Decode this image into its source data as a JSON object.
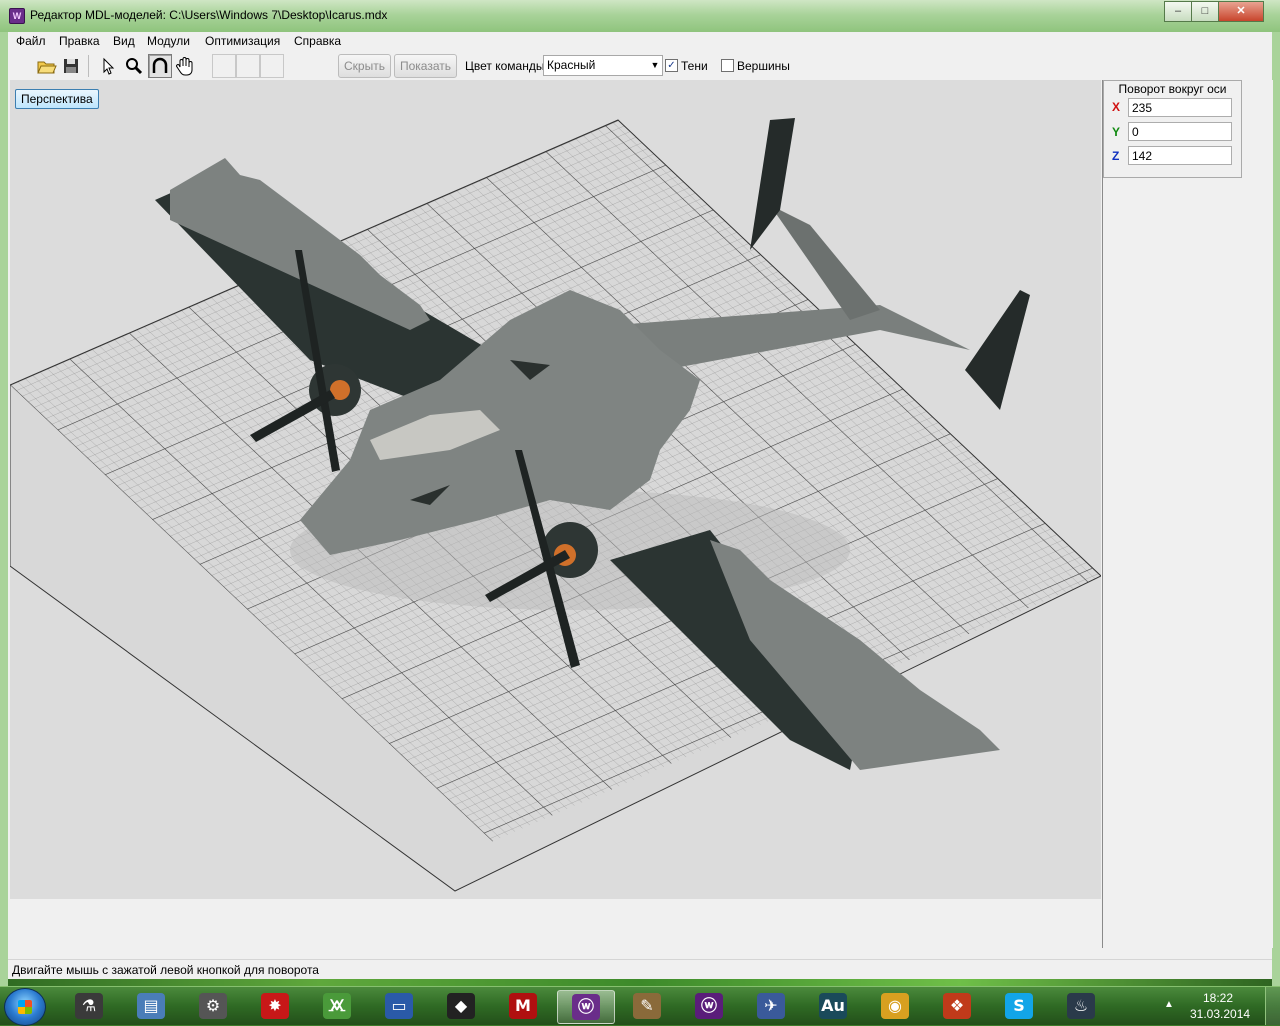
{
  "window": {
    "title": "Редактор MDL-моделей: C:\\Users\\Windows 7\\Desktop\\Icarus.mdx",
    "controls": {
      "minimize": "–",
      "maximize": "□",
      "close": "✕"
    }
  },
  "menu": [
    "Файл",
    "Правка",
    "Вид",
    "Модули",
    "Оптимизация",
    "Справка"
  ],
  "toolbar": {
    "tools": [
      {
        "name": "open-icon",
        "glyph": "📂"
      },
      {
        "name": "save-icon",
        "glyph": "💾"
      },
      {
        "name": "select-icon",
        "glyph": "↖"
      },
      {
        "name": "zoom-icon",
        "glyph": "🔍"
      },
      {
        "name": "rotate-icon",
        "glyph": "∩",
        "pressed": true
      },
      {
        "name": "pan-hand-icon",
        "glyph": "✋"
      }
    ],
    "hide_label": "Скрыть",
    "show_label": "Показать",
    "team_color_label": "Цвет команды:",
    "team_color_value": "Красный",
    "shadows_label": "Тени",
    "shadows_checked": true,
    "vertices_label": "Вершины",
    "vertices_checked": false
  },
  "viewport": {
    "mode_label": "Перспектива"
  },
  "rotation": {
    "title": "Поворот вокруг оси",
    "axes": [
      {
        "label": "X",
        "value": "235",
        "color": "#d01010"
      },
      {
        "label": "Y",
        "value": "0",
        "color": "#108a10"
      },
      {
        "label": "Z",
        "value": "142",
        "color": "#1030c0"
      }
    ]
  },
  "status": "Двигайте мышь с зажатой левой кнопкой для поворота",
  "taskbar": {
    "apps": [
      {
        "name": "flask-app-icon",
        "glyph": "⚗",
        "bg": "#3a3a3a"
      },
      {
        "name": "document-app-icon",
        "glyph": "▤",
        "bg": "#4a7db8"
      },
      {
        "name": "gear-app-icon",
        "glyph": "⚙",
        "bg": "#555555"
      },
      {
        "name": "splash-app-icon",
        "glyph": "✸",
        "bg": "#c81818"
      },
      {
        "name": "beaker-app-icon",
        "glyph": "🝪",
        "bg": "#4a9a3a"
      },
      {
        "name": "window-app-icon",
        "glyph": "▭",
        "bg": "#2a5aa8"
      },
      {
        "name": "guitar-pick-app-icon",
        "glyph": "◆",
        "bg": "#222222"
      },
      {
        "name": "m-app-icon",
        "glyph": "M",
        "bg": "#b01010"
      },
      {
        "name": "mdl-editor-app-icon",
        "glyph": "ⓦ",
        "bg": "#6a2d8a",
        "active": true
      },
      {
        "name": "scroll-app-icon",
        "glyph": "✎",
        "bg": "#8a6a3a"
      },
      {
        "name": "warcraft-app-icon",
        "glyph": "ⓦ",
        "bg": "#5a1d7a"
      },
      {
        "name": "image-editor-app-icon",
        "glyph": "✈",
        "bg": "#3a5a9a"
      },
      {
        "name": "audition-app-icon",
        "glyph": "Au",
        "bg": "#1a4a5a"
      },
      {
        "name": "chrome-app-icon",
        "glyph": "◉",
        "bg": "#d8a020"
      },
      {
        "name": "office-app-icon",
        "glyph": "❖",
        "bg": "#c03a1a"
      },
      {
        "name": "skype-app-icon",
        "glyph": "S",
        "bg": "#12a5e8"
      },
      {
        "name": "steam-app-icon",
        "glyph": "♨",
        "bg": "#2a3a4a"
      }
    ],
    "time": "18:22",
    "date": "31.03.2014"
  }
}
